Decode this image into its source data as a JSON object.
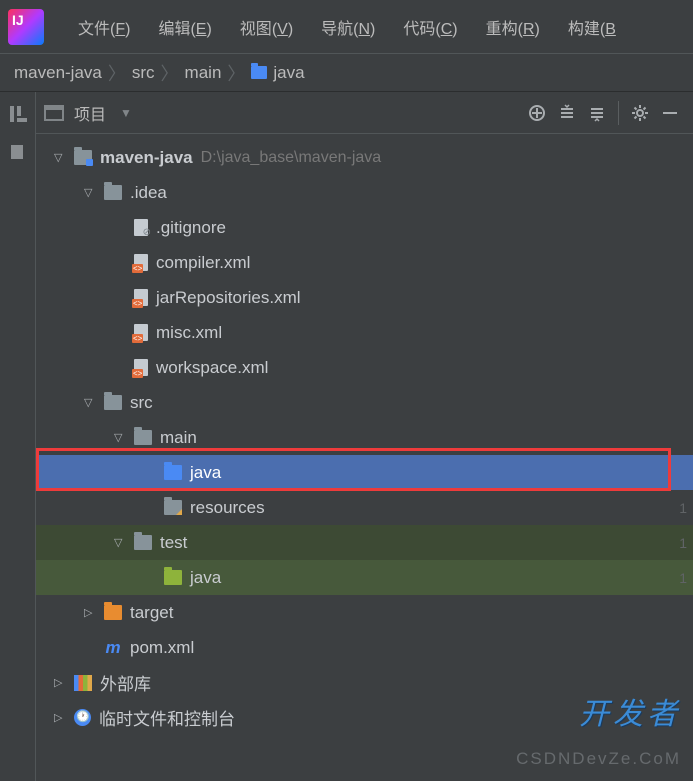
{
  "menubar": {
    "items": [
      {
        "label": "文件",
        "mnemonic": "F"
      },
      {
        "label": "编辑",
        "mnemonic": "E"
      },
      {
        "label": "视图",
        "mnemonic": "V"
      },
      {
        "label": "导航",
        "mnemonic": "N"
      },
      {
        "label": "代码",
        "mnemonic": "C"
      },
      {
        "label": "重构",
        "mnemonic": "R"
      },
      {
        "label": "构建",
        "mnemonic": "B"
      }
    ]
  },
  "breadcrumb": {
    "items": [
      "maven-java",
      "src",
      "main",
      "java"
    ]
  },
  "panel": {
    "title": "项目"
  },
  "tree": {
    "root": {
      "label": "maven-java",
      "path": "D:\\java_base\\maven-java"
    },
    "idea": ".idea",
    "files": [
      ".gitignore",
      "compiler.xml",
      "jarRepositories.xml",
      "misc.xml",
      "workspace.xml"
    ],
    "src": "src",
    "main": "main",
    "java": "java",
    "resources": "resources",
    "test": "test",
    "test_java": "java",
    "target": "target",
    "pom": "pom.xml",
    "ext_lib": "外部库",
    "scratch": "临时文件和控制台"
  },
  "line_nums": [
    "1",
    "1",
    "1"
  ],
  "watermark": {
    "brand": "开发者",
    "site": "CSDNDevZe.CoM"
  }
}
